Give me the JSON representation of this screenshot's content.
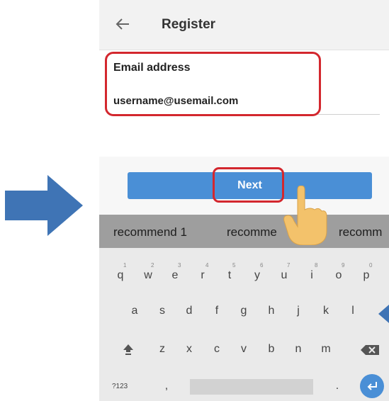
{
  "header": {
    "title": "Register"
  },
  "form": {
    "email_label": "Email address",
    "email_value": "username@usemail.com"
  },
  "actions": {
    "next_label": "Next"
  },
  "suggestions": [
    "recommend 1",
    "recomme",
    "recomm"
  ],
  "keyboard": {
    "row1": [
      "q",
      "w",
      "e",
      "r",
      "t",
      "y",
      "u",
      "i",
      "o",
      "p"
    ],
    "row1_hints": [
      "1",
      "2",
      "3",
      "4",
      "5",
      "6",
      "7",
      "8",
      "9",
      "0"
    ],
    "row2": [
      "a",
      "s",
      "d",
      "f",
      "g",
      "h",
      "j",
      "k",
      "l"
    ],
    "row3": [
      "z",
      "x",
      "c",
      "v",
      "b",
      "n",
      "m"
    ],
    "mode_key": "?123",
    "comma_key": ",",
    "period_key": "."
  },
  "colors": {
    "accent": "#4a8fd6",
    "highlight": "#d3272e",
    "pointer_arrow": "#3f74b5"
  }
}
